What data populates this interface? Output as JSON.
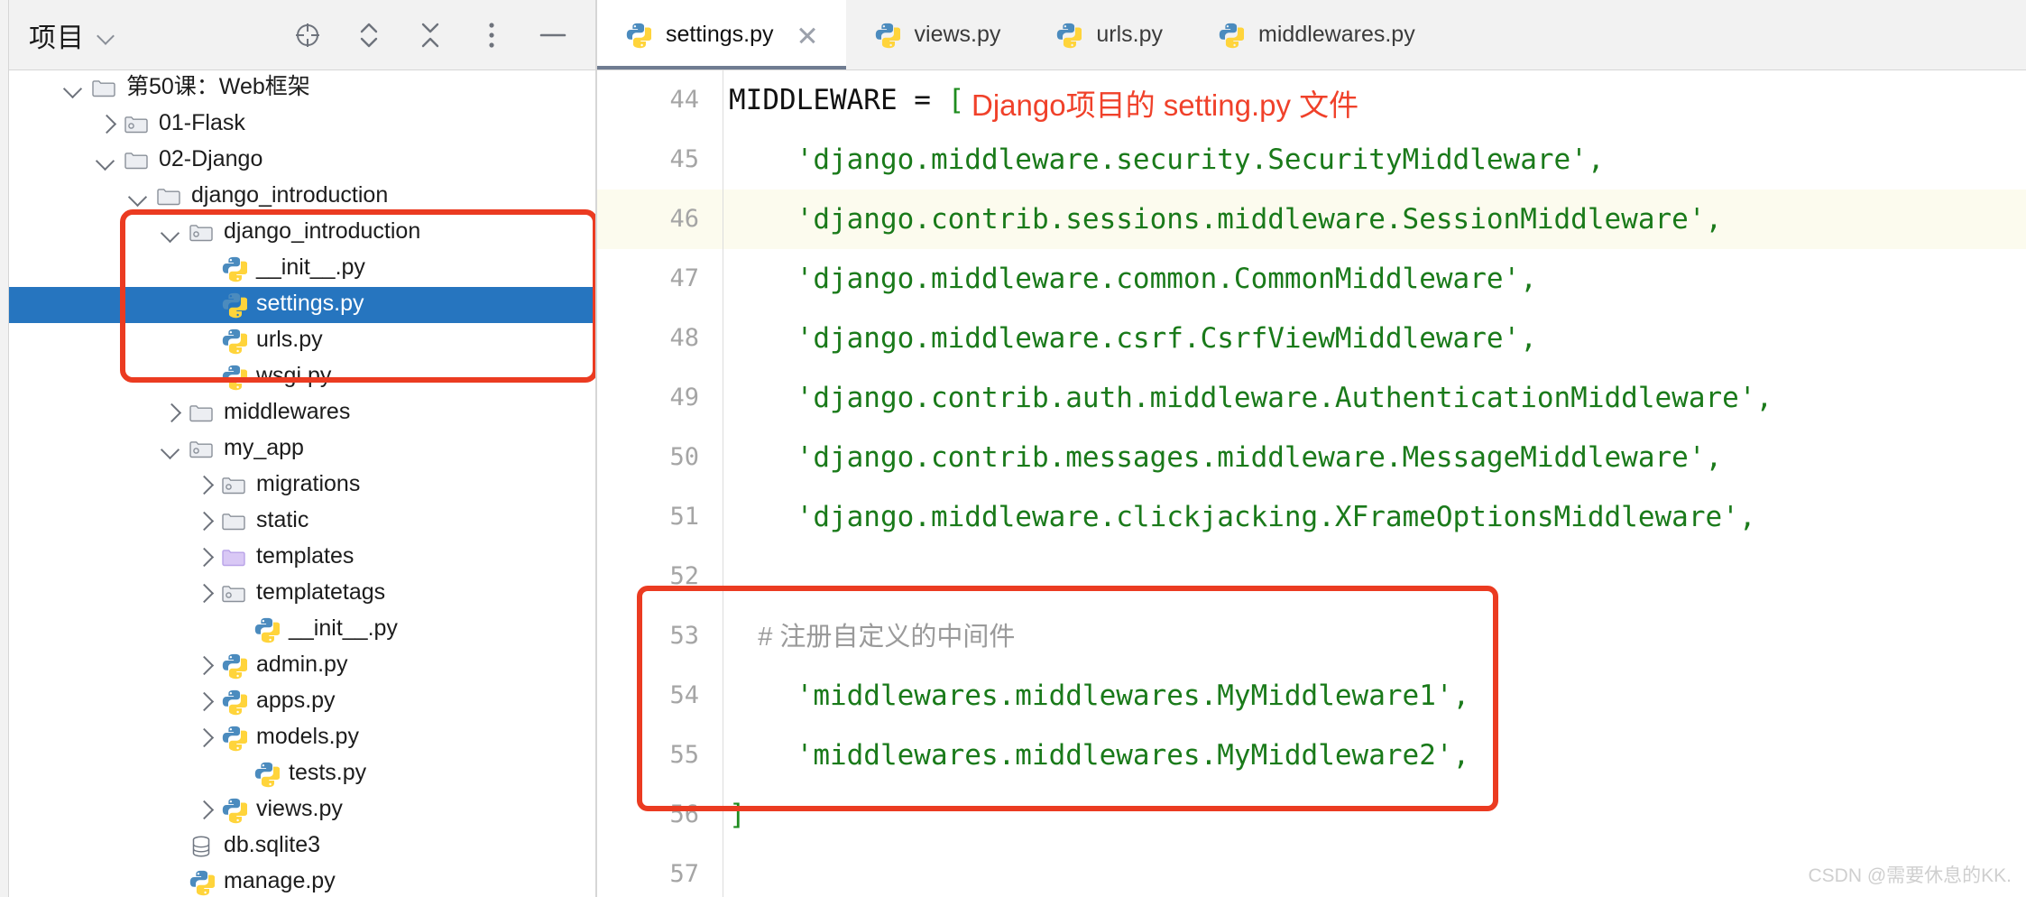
{
  "project_panel": {
    "title": "项目",
    "title_caret_icon": "chevron-down-icon",
    "toolbar_icons": [
      {
        "name": "select-opened-file-icon",
        "glyph": "target"
      },
      {
        "name": "expand-collapse-icon",
        "glyph": "up-down-chevrons"
      },
      {
        "name": "collapse-all-icon",
        "glyph": "collapse-x"
      },
      {
        "name": "more-options-icon",
        "glyph": "vertical-dots"
      },
      {
        "name": "hide-panel-icon",
        "glyph": "minus"
      }
    ],
    "tree": [
      {
        "label": "第50课：Web框架",
        "indent": 1,
        "twisty": "down",
        "icon": "folder",
        "selected": false
      },
      {
        "label": "01-Flask",
        "indent": 2,
        "twisty": "right",
        "icon": "folder-module",
        "selected": false
      },
      {
        "label": "02-Django",
        "indent": 2,
        "twisty": "down",
        "icon": "folder",
        "selected": false
      },
      {
        "label": "django_introduction",
        "indent": 3,
        "twisty": "down",
        "icon": "folder",
        "selected": false
      },
      {
        "label": "django_introduction",
        "indent": 4,
        "twisty": "down",
        "icon": "folder-module",
        "selected": false
      },
      {
        "label": "__init__.py",
        "indent": 5,
        "twisty": "none",
        "icon": "python",
        "selected": false
      },
      {
        "label": "settings.py",
        "indent": 5,
        "twisty": "none",
        "icon": "python",
        "selected": true
      },
      {
        "label": "urls.py",
        "indent": 5,
        "twisty": "none",
        "icon": "python",
        "selected": false
      },
      {
        "label": "wsgi.py",
        "indent": 5,
        "twisty": "none",
        "icon": "python",
        "selected": false
      },
      {
        "label": "middlewares",
        "indent": 4,
        "twisty": "right",
        "icon": "folder",
        "selected": false
      },
      {
        "label": "my_app",
        "indent": 4,
        "twisty": "down",
        "icon": "folder-module",
        "selected": false
      },
      {
        "label": "migrations",
        "indent": 5,
        "twisty": "right",
        "icon": "folder-module",
        "selected": false
      },
      {
        "label": "static",
        "indent": 5,
        "twisty": "right",
        "icon": "folder",
        "selected": false
      },
      {
        "label": "templates",
        "indent": 5,
        "twisty": "right",
        "icon": "folder-templates",
        "selected": false
      },
      {
        "label": "templatetags",
        "indent": 5,
        "twisty": "right",
        "icon": "folder-module",
        "selected": false
      },
      {
        "label": "__init__.py",
        "indent": 6,
        "twisty": "none",
        "icon": "python",
        "selected": false
      },
      {
        "label": "admin.py",
        "indent": 5,
        "twisty": "right",
        "icon": "python",
        "selected": false
      },
      {
        "label": "apps.py",
        "indent": 5,
        "twisty": "right",
        "icon": "python",
        "selected": false
      },
      {
        "label": "models.py",
        "indent": 5,
        "twisty": "right",
        "icon": "python",
        "selected": false
      },
      {
        "label": "tests.py",
        "indent": 6,
        "twisty": "none",
        "icon": "python",
        "selected": false
      },
      {
        "label": "views.py",
        "indent": 5,
        "twisty": "right",
        "icon": "python",
        "selected": false
      },
      {
        "label": "db.sqlite3",
        "indent": 4,
        "twisty": "none",
        "icon": "database",
        "selected": false
      },
      {
        "label": "manage.py",
        "indent": 4,
        "twisty": "none",
        "icon": "python",
        "selected": false
      }
    ]
  },
  "editor": {
    "tabs": [
      {
        "label": "settings.py",
        "icon": "python-icon",
        "active": true,
        "closable": true
      },
      {
        "label": "views.py",
        "icon": "python-icon",
        "active": false,
        "closable": false
      },
      {
        "label": "urls.py",
        "icon": "python-icon",
        "active": false,
        "closable": false
      },
      {
        "label": "middlewares.py",
        "icon": "python-icon",
        "active": false,
        "closable": false
      }
    ],
    "lines": [
      {
        "no": "44",
        "highlight": false,
        "tokens": [
          {
            "t": "MIDDLEWARE = ",
            "c": "kw"
          },
          {
            "t": "[",
            "c": "brk"
          }
        ]
      },
      {
        "no": "45",
        "highlight": false,
        "tokens": [
          {
            "t": "    'django.middleware.security.SecurityMiddleware',",
            "c": "str"
          }
        ]
      },
      {
        "no": "46",
        "highlight": true,
        "tokens": [
          {
            "t": "    'django.contrib.sessions.middleware.SessionMiddleware',",
            "c": "str"
          }
        ]
      },
      {
        "no": "47",
        "highlight": false,
        "tokens": [
          {
            "t": "    'django.middleware.common.CommonMiddleware',",
            "c": "str"
          }
        ]
      },
      {
        "no": "48",
        "highlight": false,
        "tokens": [
          {
            "t": "    'django.middleware.csrf.CsrfViewMiddleware',",
            "c": "str"
          }
        ]
      },
      {
        "no": "49",
        "highlight": false,
        "tokens": [
          {
            "t": "    'django.contrib.auth.middleware.AuthenticationMiddleware',",
            "c": "str"
          }
        ]
      },
      {
        "no": "50",
        "highlight": false,
        "tokens": [
          {
            "t": "    'django.contrib.messages.middleware.MessageMiddleware',",
            "c": "str"
          }
        ]
      },
      {
        "no": "51",
        "highlight": false,
        "tokens": [
          {
            "t": "    'django.middleware.clickjacking.XFrameOptionsMiddleware',",
            "c": "str"
          }
        ]
      },
      {
        "no": "52",
        "highlight": false,
        "tokens": []
      },
      {
        "no": "53",
        "highlight": false,
        "tokens": [
          {
            "t": "    # 注册自定义的中间件",
            "c": "cmt"
          }
        ]
      },
      {
        "no": "54",
        "highlight": false,
        "tokens": [
          {
            "t": "    'middlewares.middlewares.MyMiddleware1',",
            "c": "str"
          }
        ]
      },
      {
        "no": "55",
        "highlight": false,
        "tokens": [
          {
            "t": "    'middlewares.middlewares.MyMiddleware2',",
            "c": "str"
          }
        ]
      },
      {
        "no": "56",
        "highlight": false,
        "tokens": [
          {
            "t": "]",
            "c": "brk"
          }
        ]
      },
      {
        "no": "57",
        "highlight": false,
        "tokens": []
      }
    ],
    "annotation_label": "Django项目的 setting.py 文件"
  },
  "watermark": "CSDN @需要休息的KK.",
  "colors": {
    "accent_selection": "#2675bf",
    "annotation_red": "#eb3b21",
    "string_green": "#1a7a1a",
    "line_highlight": "#fcfbee"
  }
}
